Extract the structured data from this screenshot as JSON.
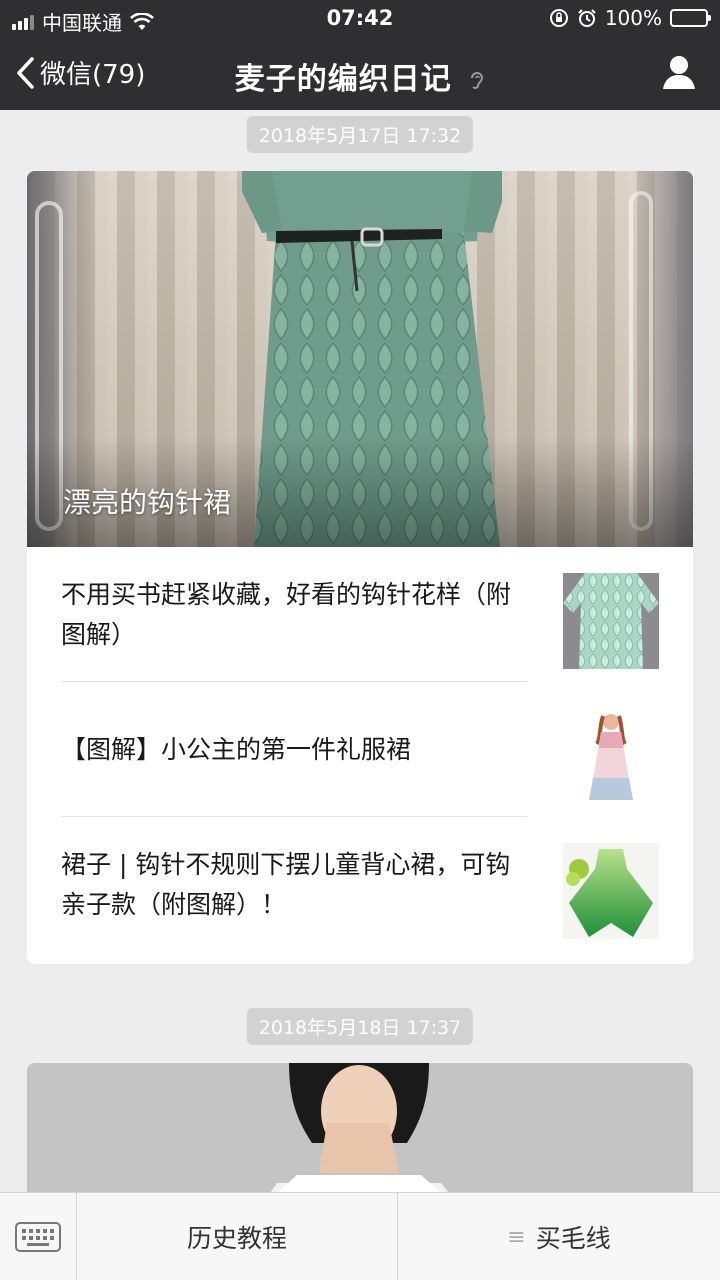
{
  "status": {
    "carrier": "中国联通",
    "time": "07:42",
    "battery": "100%"
  },
  "nav": {
    "back_label": "微信(79)",
    "title": "麦子的编织日记"
  },
  "messages": [
    {
      "timestamp": "2018年5月17日 17:32",
      "cover_caption": "漂亮的钩针裙",
      "items": [
        {
          "title": "不用买书赶紧收藏，好看的钩针花样（附图解）"
        },
        {
          "title": "【图解】小公主的第一件礼服裙"
        },
        {
          "title": "裙子 | 钩针不规则下摆儿童背心裙，可钩亲子款（附图解）！"
        }
      ]
    },
    {
      "timestamp": "2018年5月18日 17:37"
    }
  ],
  "bottom_menu": {
    "menu1": "历史教程",
    "menu2_symbol": "≡",
    "menu2": "买毛线"
  }
}
